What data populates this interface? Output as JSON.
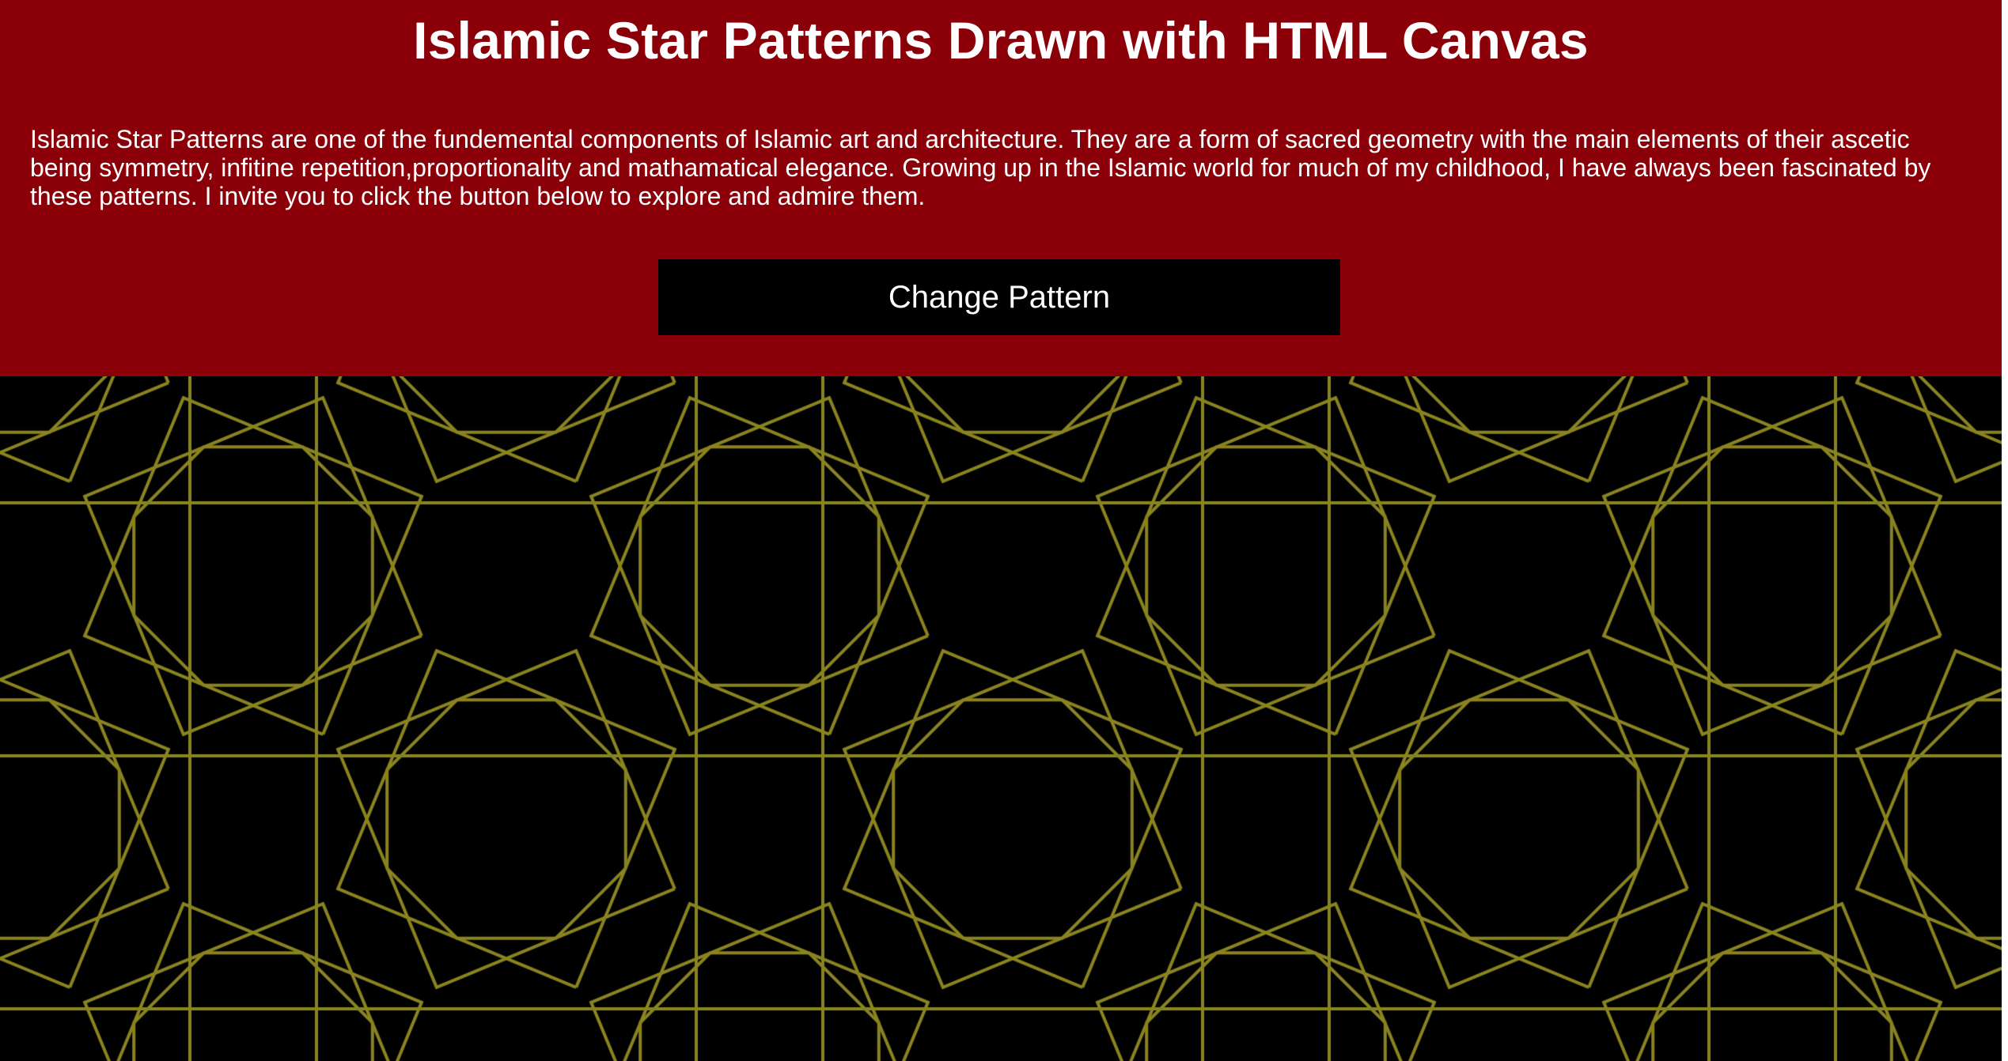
{
  "header": {
    "title": "Islamic Star Patterns Drawn with HTML Canvas",
    "intro": "Islamic Star Patterns are one of the fundemental components of Islamic art and architecture. They are a form of sacred geometry with the main elements of their ascetic being symmetry, infitine repetition,proportionality and mathamatical elegance. Growing up in the Islamic world for much of my childhood, I have always been fascinated by these patterns. I invite you to click the button below to explore and admire them.",
    "button_label": "Change Pattern"
  },
  "colors": {
    "header_background": "#8b0008",
    "header_text": "#ffffff",
    "button_background": "#000000",
    "canvas_background": "#000000",
    "pattern_stroke": "#8a8420"
  },
  "pattern": {
    "type": "eight-pointed star tiling"
  }
}
